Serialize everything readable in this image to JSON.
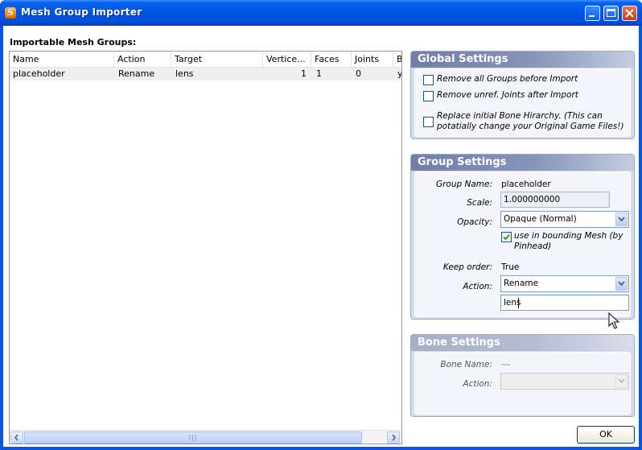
{
  "window": {
    "title": "Mesh Group Importer",
    "app_icon": "S"
  },
  "list": {
    "label": "Importable Mesh Groups:",
    "columns": [
      "Name",
      "Action",
      "Target",
      "Vertice...",
      "Faces",
      "Joints",
      "B"
    ],
    "rows": [
      {
        "name": "placeholder",
        "action": "Rename",
        "target": "lens",
        "vertices": "1",
        "faces": "1",
        "joints": "0",
        "b": "y"
      }
    ],
    "scroll": {
      "left": "<",
      "right": ">",
      "thumb": "|||"
    }
  },
  "global_settings": {
    "title": "Global Settings",
    "options": [
      {
        "label": "Remove all Groups before Import",
        "checked": false
      },
      {
        "label": "Remove unref. Joints after Import",
        "checked": false
      },
      {
        "label": "Replace initial Bone  Hirarchy. (This can potatially change your Original Game Files!)",
        "checked": false
      }
    ]
  },
  "group_settings": {
    "title": "Group Settings",
    "group_name_label": "Group Name:",
    "group_name_value": "placeholder",
    "scale_label": "Scale:",
    "scale_value": "1.000000000",
    "opacity_label": "Opacity:",
    "opacity_value": "Opaque (Normal)",
    "bounding_label": "use in bounding Mesh (by Pinhead)",
    "bounding_checked": true,
    "keep_order_label": "Keep order:",
    "keep_order_value": "True",
    "action_label": "Action:",
    "action_value": "Rename",
    "target_value": "lens"
  },
  "bone_settings": {
    "title": "Bone Settings",
    "bone_name_label": "Bone Name:",
    "bone_name_value": "---",
    "action_label": "Action:",
    "action_value": ""
  },
  "ok_label": "OK"
}
